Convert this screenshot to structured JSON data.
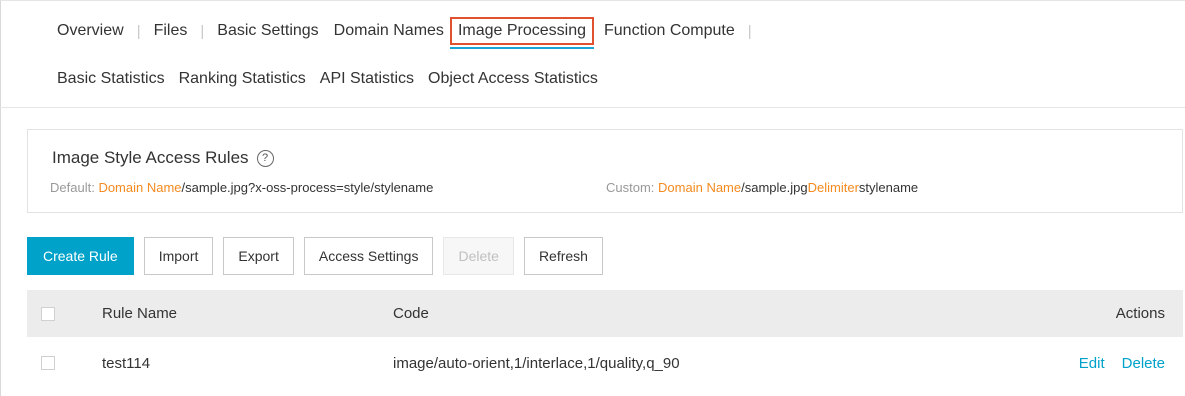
{
  "tabs_row1": {
    "overview": "Overview",
    "files": "Files",
    "basic_settings": "Basic Settings",
    "domain_names": "Domain Names",
    "image_processing": "Image Processing",
    "function_compute": "Function Compute"
  },
  "tabs_row2": {
    "basic_statistics": "Basic Statistics",
    "ranking_statistics": "Ranking Statistics",
    "api_statistics": "API Statistics",
    "object_access_statistics": "Object Access Statistics"
  },
  "info": {
    "title": "Image Style Access Rules",
    "default_label": "Default:",
    "default_domain": "Domain Name",
    "default_path": "/sample.jpg?x-oss-process=style/stylename",
    "custom_label": "Custom:",
    "custom_domain": "Domain Name",
    "custom_path": "/sample.jpg",
    "custom_delimiter": "Delimiter",
    "custom_suffix": "stylename"
  },
  "toolbar": {
    "create_rule": "Create Rule",
    "import": "Import",
    "export": "Export",
    "access_settings": "Access Settings",
    "delete": "Delete",
    "refresh": "Refresh"
  },
  "table": {
    "headers": {
      "rule_name": "Rule Name",
      "code": "Code",
      "actions": "Actions"
    },
    "rows": [
      {
        "rule_name": "test114",
        "code": "image/auto-orient,1/interlace,1/quality,q_90",
        "edit": "Edit",
        "delete": "Delete"
      }
    ]
  },
  "colors": {
    "accent": "#00a2ca",
    "highlight_border": "#e0522f",
    "tab_underline": "#1aa5d4",
    "orange_text": "#f58a1f"
  }
}
